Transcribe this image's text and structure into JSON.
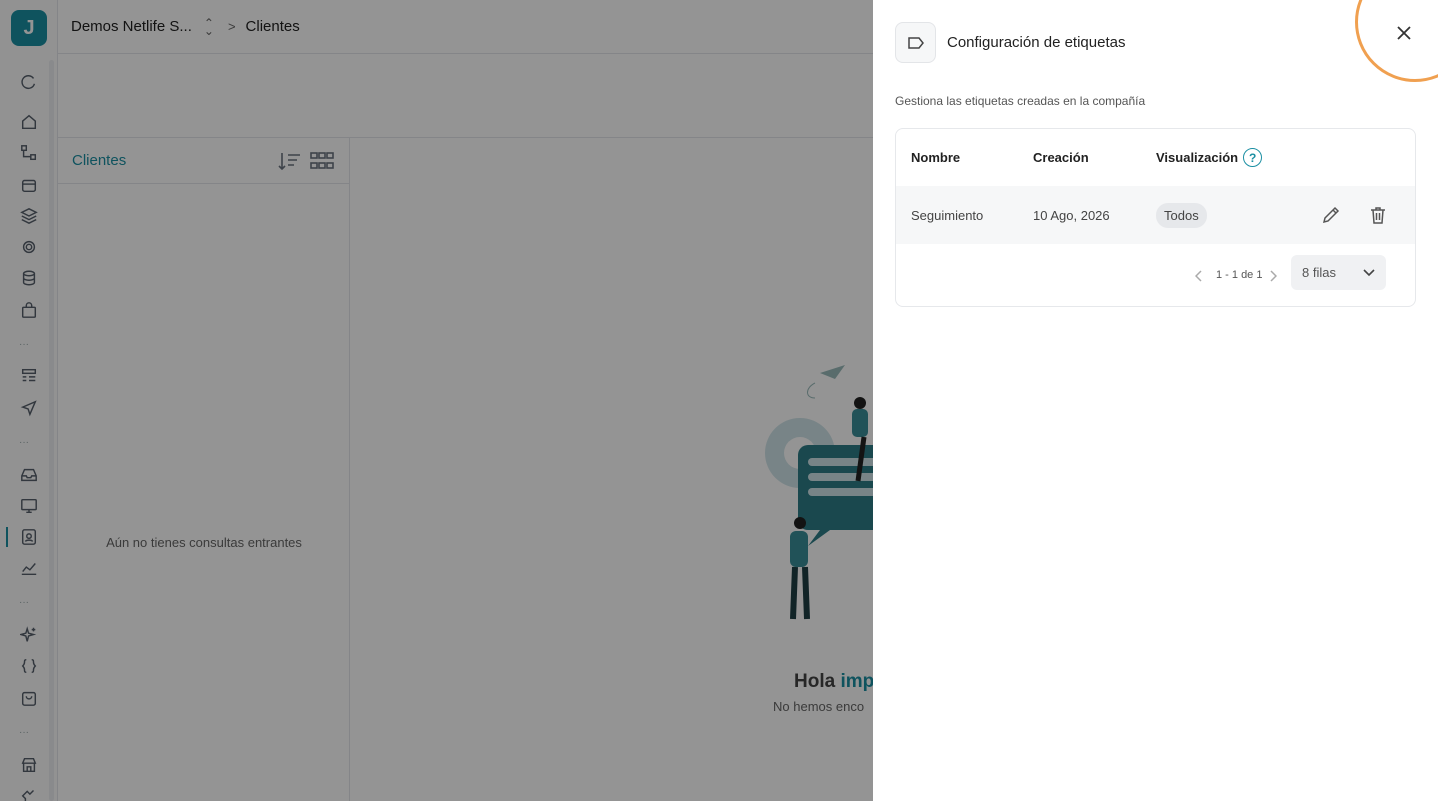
{
  "app": {
    "logo_letter": "J"
  },
  "topbar": {
    "company": "Demos Netlife S...",
    "breadcrumb_current": "Clientes"
  },
  "list": {
    "title": "Clientes",
    "empty_message": "Aún no tienes consultas entrantes"
  },
  "main": {
    "greeting": "Hola",
    "greeting_accent": "impo",
    "subtitle": "No hemos enco"
  },
  "drawer": {
    "title": "Configuración de etiquetas",
    "description": "Gestiona las etiquetas creadas en la compañía",
    "columns": {
      "name": "Nombre",
      "created": "Creación",
      "visibility": "Visualización"
    },
    "help_glyph": "?",
    "rows": [
      {
        "name": "Seguimiento",
        "created": "10 Ago, 2026",
        "visibility": "Todos"
      }
    ],
    "pagination": {
      "range": "1 - 1 de 1",
      "rows_per_page": "8 filas"
    }
  },
  "colors": {
    "accent": "#1b8fa3",
    "highlight_ring": "#f0a050"
  }
}
